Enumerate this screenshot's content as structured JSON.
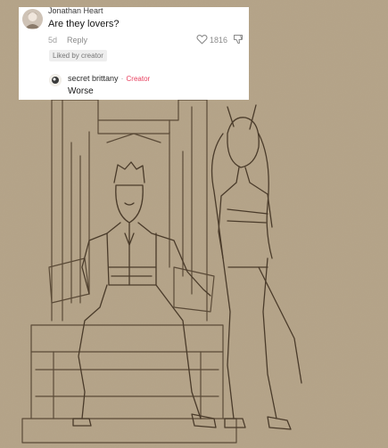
{
  "comment": {
    "username": "Jonathan Heart",
    "text": "Are they lovers?",
    "age": "5d",
    "reply_label": "Reply",
    "liked_badge": "Liked by creator",
    "like_count": "1816"
  },
  "reply": {
    "username": "secret brittany",
    "separator": "·",
    "creator_tag": "Creator",
    "text": "Worse"
  },
  "colors": {
    "creator_accent": "#e8405f",
    "background_paper": "#b6a58a",
    "sketch_line": "#5a4a37"
  },
  "icons": {
    "like": "heart-outline-icon",
    "dislike": "thumbs-down-icon"
  }
}
